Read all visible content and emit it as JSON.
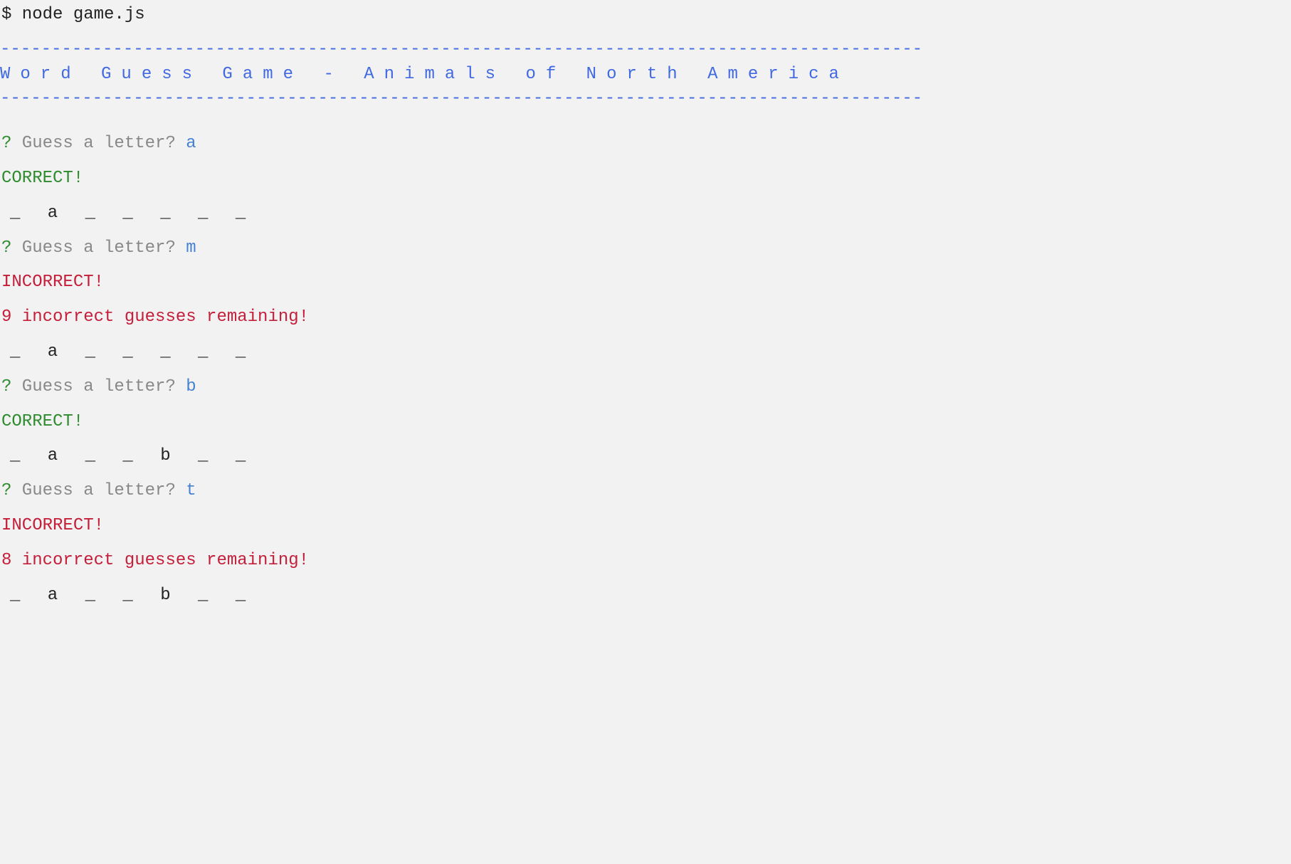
{
  "command": "$ node game.js",
  "divider": "------------------------------------------------------------------------------------------",
  "title": "Word Guess Game - Animals of North America",
  "turns": [
    {
      "prompt_mark": "?",
      "prompt_text": " Guess a letter? ",
      "answer": "a",
      "result": "CORRECT!",
      "result_type": "correct",
      "remaining": "",
      "word_state": "_ a _ _ _ _ _"
    },
    {
      "prompt_mark": "?",
      "prompt_text": " Guess a letter? ",
      "answer": "m",
      "result": "INCORRECT!",
      "result_type": "incorrect",
      "remaining": "9 incorrect guesses remaining!",
      "word_state": "_ a _ _ _ _ _"
    },
    {
      "prompt_mark": "?",
      "prompt_text": " Guess a letter? ",
      "answer": "b",
      "result": "CORRECT!",
      "result_type": "correct",
      "remaining": "",
      "word_state": "_ a _ _ b _ _"
    },
    {
      "prompt_mark": "?",
      "prompt_text": " Guess a letter? ",
      "answer": "t",
      "result": "INCORRECT!",
      "result_type": "incorrect",
      "remaining": "8 incorrect guesses remaining!",
      "word_state": "_ a _ _ b _ _"
    }
  ]
}
